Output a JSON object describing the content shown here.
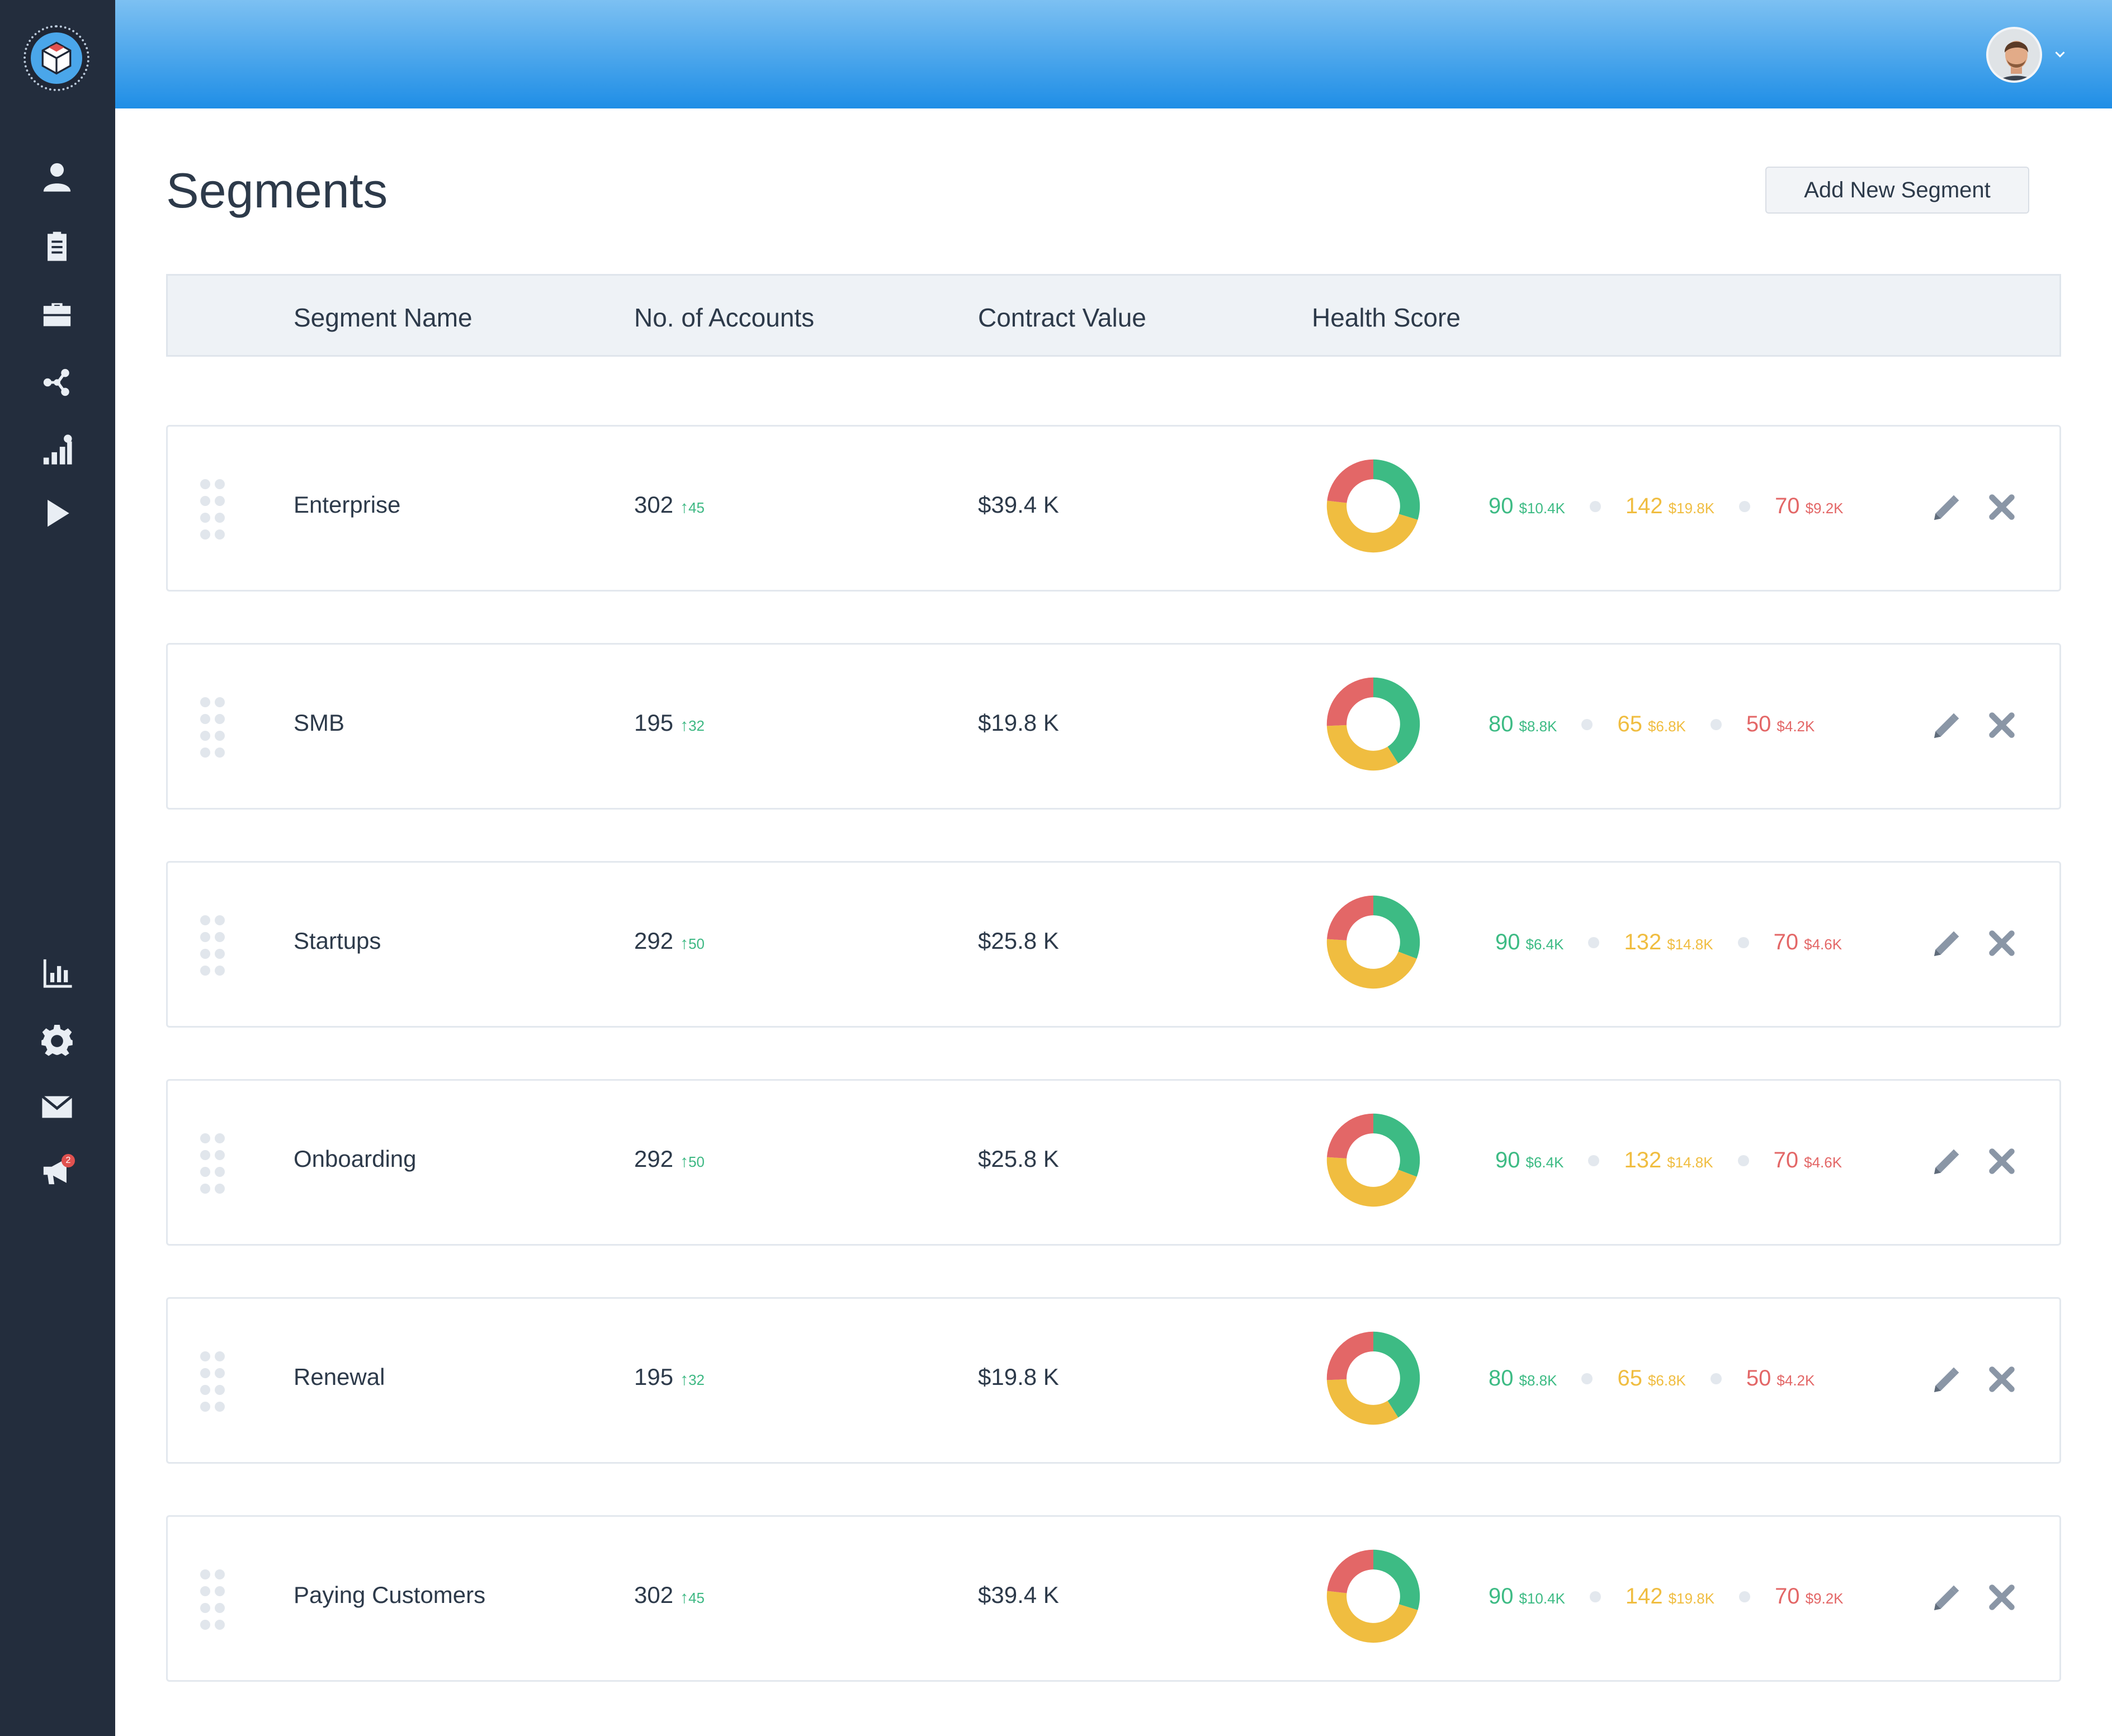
{
  "page": {
    "title": "Segments"
  },
  "actions": {
    "add_label": "Add New Segment"
  },
  "notifications": {
    "badge_count": "2"
  },
  "columns": [
    "Segment Name",
    "No. of Accounts",
    "Contract Value",
    "Health Score"
  ],
  "colors": {
    "good": "#3dbb84",
    "warn": "#f0bd40",
    "bad": "#e36767"
  },
  "segments": [
    {
      "name": "Enterprise",
      "accounts": "302",
      "accounts_delta": "45",
      "contract": "$39.4 K",
      "good_count": "90",
      "good_value": "$10.4K",
      "warn_count": "142",
      "warn_value": "$19.8K",
      "bad_count": "70",
      "bad_value": "$9.2K",
      "donut": [
        90,
        142,
        70
      ]
    },
    {
      "name": "SMB",
      "accounts": "195",
      "accounts_delta": "32",
      "contract": "$19.8 K",
      "good_count": "80",
      "good_value": "$8.8K",
      "warn_count": "65",
      "warn_value": "$6.8K",
      "bad_count": "50",
      "bad_value": "$4.2K",
      "donut": [
        80,
        65,
        50
      ]
    },
    {
      "name": "Startups",
      "accounts": "292",
      "accounts_delta": "50",
      "contract": "$25.8 K",
      "good_count": "90",
      "good_value": "$6.4K",
      "warn_count": "132",
      "warn_value": "$14.8K",
      "bad_count": "70",
      "bad_value": "$4.6K",
      "donut": [
        90,
        132,
        70
      ]
    },
    {
      "name": "Onboarding",
      "accounts": "292",
      "accounts_delta": "50",
      "contract": "$25.8 K",
      "good_count": "90",
      "good_value": "$6.4K",
      "warn_count": "132",
      "warn_value": "$14.8K",
      "bad_count": "70",
      "bad_value": "$4.6K",
      "donut": [
        90,
        132,
        70
      ]
    },
    {
      "name": "Renewal",
      "accounts": "195",
      "accounts_delta": "32",
      "contract": "$19.8 K",
      "good_count": "80",
      "good_value": "$8.8K",
      "warn_count": "65",
      "warn_value": "$6.8K",
      "bad_count": "50",
      "bad_value": "$4.2K",
      "donut": [
        80,
        65,
        50
      ]
    },
    {
      "name": "Paying Customers",
      "accounts": "302",
      "accounts_delta": "45",
      "contract": "$39.4 K",
      "good_count": "90",
      "good_value": "$10.4K",
      "warn_count": "142",
      "warn_value": "$19.8K",
      "bad_count": "70",
      "bad_value": "$9.2K",
      "donut": [
        90,
        142,
        70
      ]
    }
  ]
}
